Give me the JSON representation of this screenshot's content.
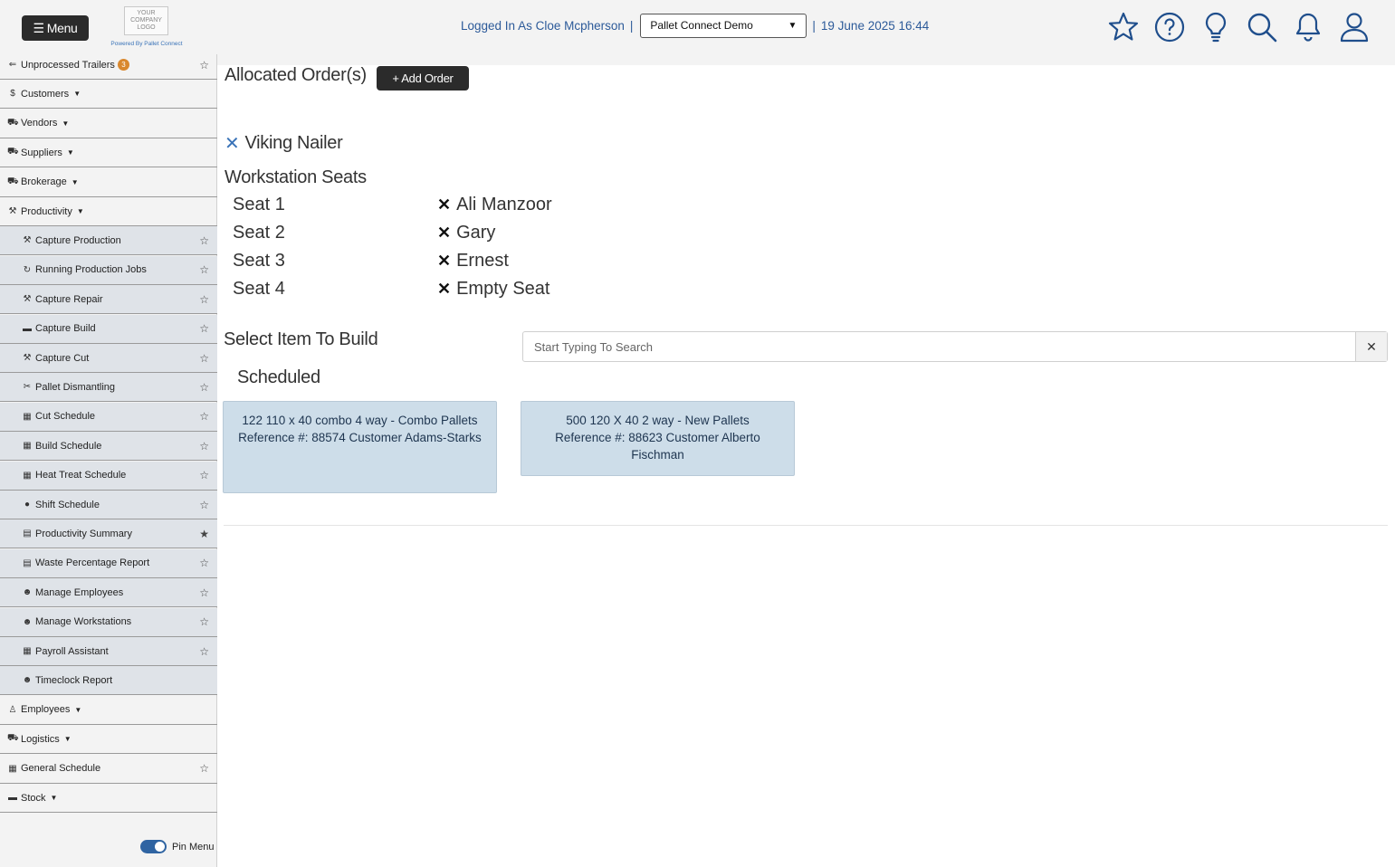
{
  "header": {
    "menu_label": "Menu",
    "logo_text": "YOUR COMPANY LOGO",
    "powered_by": "Powered By Pallet Connect",
    "logged_in": "Logged In As Cloe Mcpherson",
    "separator": "|",
    "company_selected": "Pallet Connect Demo",
    "datetime": "19 June 2025 16:44",
    "icons": [
      "star-icon",
      "help-icon",
      "lightbulb-icon",
      "search-icon",
      "bell-icon",
      "user-icon"
    ]
  },
  "sidebar": {
    "top_items": [
      {
        "icon": "trailer-icon",
        "label": "Unprocessed Trailers",
        "badge": "3"
      },
      {
        "icon": "dollar-icon",
        "label": "Customers"
      },
      {
        "icon": "truck-icon",
        "label": "Vendors"
      },
      {
        "icon": "truck-icon",
        "label": "Suppliers"
      },
      {
        "icon": "truck-icon",
        "label": "Brokerage"
      },
      {
        "icon": "hammer-icon",
        "label": "Productivity"
      }
    ],
    "productivity_items": [
      {
        "icon": "hammer-icon",
        "label": "Capture Production",
        "favorite": false
      },
      {
        "icon": "refresh-icon",
        "label": "Running Production Jobs",
        "favorite": false
      },
      {
        "icon": "hammer-icon",
        "label": "Capture Repair",
        "favorite": false
      },
      {
        "icon": "pallet-icon",
        "label": "Capture Build",
        "favorite": false
      },
      {
        "icon": "axe-icon",
        "label": "Capture Cut",
        "favorite": false
      },
      {
        "icon": "tools-icon",
        "label": "Pallet Dismantling",
        "favorite": false
      },
      {
        "icon": "calendar-icon",
        "label": "Cut Schedule",
        "favorite": false
      },
      {
        "icon": "calendar-icon",
        "label": "Build Schedule",
        "favorite": false
      },
      {
        "icon": "calendar-icon",
        "label": "Heat Treat Schedule",
        "favorite": false
      },
      {
        "icon": "clock-icon",
        "label": "Shift Schedule",
        "favorite": false
      },
      {
        "icon": "table-icon",
        "label": "Productivity Summary",
        "favorite": true
      },
      {
        "icon": "table-icon",
        "label": "Waste Percentage Report",
        "favorite": false
      },
      {
        "icon": "users-icon",
        "label": "Manage Employees",
        "favorite": false
      },
      {
        "icon": "users-icon",
        "label": "Manage Workstations",
        "favorite": false
      },
      {
        "icon": "calendar-icon",
        "label": "Payroll Assistant",
        "favorite": false
      },
      {
        "icon": "user-clock-icon",
        "label": "Timeclock Report"
      }
    ],
    "bottom_items": [
      {
        "icon": "person-icon",
        "label": "Employees"
      },
      {
        "icon": "truck-icon",
        "label": "Logistics"
      },
      {
        "icon": "calendar-icon",
        "label": "General Schedule"
      },
      {
        "icon": "pallet-icon",
        "label": "Stock"
      }
    ],
    "pin_menu_label": "Pin Menu",
    "pin_menu_on": true
  },
  "main": {
    "allocated_title": "Allocated Order(s)",
    "add_order_label": "+ Add Order",
    "machine_name": "Viking Nailer",
    "workstation_title": "Workstation Seats",
    "seats": [
      {
        "seat": "Seat 1",
        "employee": "Ali Manzoor"
      },
      {
        "seat": "Seat 2",
        "employee": "Gary"
      },
      {
        "seat": "Seat 3",
        "employee": "Ernest"
      },
      {
        "seat": "Seat 4",
        "employee": "Empty Seat"
      }
    ],
    "select_title": "Select Item To Build",
    "search_placeholder": "Start Typing To Search",
    "search_value": "",
    "clear_symbol": "✕",
    "scheduled_title": "Scheduled",
    "scheduled_jobs": [
      {
        "line1": "122 110 x 40 combo 4 way - Combo Pallets",
        "line2": "Reference #: 88574 Customer Adams-Starks"
      },
      {
        "line1": "500 120 X 40 2 way - New Pallets",
        "line2": "Reference #: 88623 Customer Alberto Fischman"
      }
    ]
  },
  "colors": {
    "header_bg": "#f3f3f3",
    "accent_blue": "#2c5a99",
    "card_bg": "#cddde9",
    "button_dark": "#2b2b2b",
    "badge_orange": "#d9882e"
  }
}
